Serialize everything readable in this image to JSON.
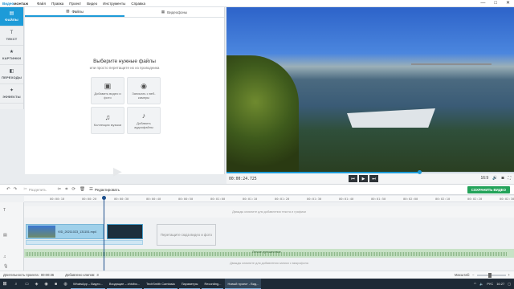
{
  "app": {
    "logo_primary": "Видео",
    "logo_secondary": "МОНТАЖ"
  },
  "menu": [
    "Файл",
    "Правка",
    "Проект",
    "Видео",
    "Инструменты",
    "Справка"
  ],
  "window_controls": {
    "minimize": "—",
    "maximize": "□",
    "close": "✕"
  },
  "sidebar": [
    {
      "label": "ФАЙЛЫ",
      "icon": "▤",
      "active": true
    },
    {
      "label": "ТЕКСТ",
      "icon": "T",
      "active": false
    },
    {
      "label": "КАРТИНКИ",
      "icon": "★",
      "active": false
    },
    {
      "label": "ПЕРЕХОДЫ",
      "icon": "◧",
      "active": false
    },
    {
      "label": "ЭФФЕКТЫ",
      "icon": "✦",
      "active": false
    }
  ],
  "tabs": [
    {
      "label": "Файлы",
      "icon": "▥",
      "active": true
    },
    {
      "label": "Видеофоны",
      "icon": "▦",
      "active": false
    }
  ],
  "add_panel": {
    "title": "Выберите нужные файлы",
    "subtitle": "или просто перетащите их из проводника",
    "cards": [
      {
        "label": "Добавить видео и фото",
        "icon": "▣"
      },
      {
        "label": "Записать с веб-камеры",
        "icon": "◉"
      },
      {
        "label": "Коллекция музыки",
        "icon": "♫"
      },
      {
        "label": "Добавить аудиофайлы",
        "icon": "♪"
      }
    ]
  },
  "preview": {
    "time": "00:00:24.725",
    "progress": 0.67,
    "aspect": "16:9",
    "buttons": {
      "prev": "⏮",
      "play": "▶",
      "next": "⏭"
    }
  },
  "toolbar": {
    "split_label": "Разделить",
    "edit_label": "Редактировать",
    "export_label": "СОХРАНИТЬ ВИДЕО"
  },
  "timeline": {
    "ticks": [
      "00:00:10",
      "00:00:20",
      "00:00:30",
      "00:00:40",
      "00:00:50",
      "00:01:00",
      "00:01:10",
      "00:01:20",
      "00:01:30",
      "00:01:40",
      "00:01:50",
      "00:02:00",
      "00:02:10",
      "00:02:20",
      "00:02:30"
    ],
    "text_lane_hint": "Дважды кликните для добавления текста и графики",
    "clip_name": "VID_20211023_131151.mp4",
    "drop_hint": "Перетащите сюда видео и фото",
    "music_label": "Легкое путешествие",
    "voice_lane_hint": "Дважды кликните для добавления записи с микрофона",
    "playhead": 0.17
  },
  "statusbar": {
    "duration_label": "Длительность проекта:",
    "duration_value": "00:00:36",
    "clips_label": "Добавлено клипов:",
    "clips_value": "3",
    "zoom_label": "Масштаб:"
  },
  "taskbar": {
    "start_icon": "⊞",
    "search_icon": "⌕",
    "pinned": [
      "▭",
      "◈",
      "◉",
      "■",
      "◍"
    ],
    "apps": [
      {
        "label": "WhatsApp – Видео..."
      },
      {
        "label": "Входящие – zhivibo..."
      },
      {
        "label": "TechSmith Camtasia"
      },
      {
        "label": "Параметры"
      },
      {
        "label": "Recording..."
      },
      {
        "label": "Новый проект - Вид..."
      }
    ],
    "lang": "РУС",
    "time": "16:27"
  }
}
